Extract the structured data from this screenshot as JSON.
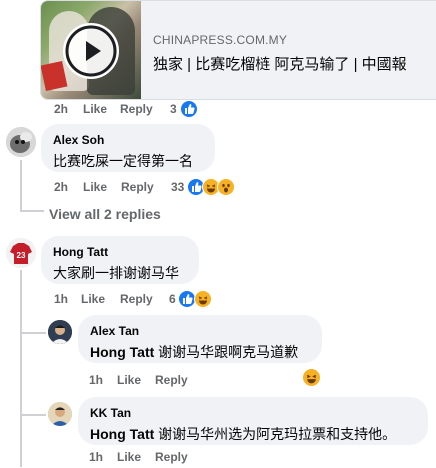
{
  "link_preview": {
    "domain": "CHINAPRESS.COM.MY",
    "title": "独家 | 比赛吃榴梿 阿克马输了 | 中國報",
    "thumbnail_icon": "video-play-icon"
  },
  "top_meta": {
    "time": "2h",
    "like": "Like",
    "reply": "Reply",
    "count": "3"
  },
  "comments": [
    {
      "author": "Alex Soh",
      "text": "比赛吃屎一定得第一名",
      "time": "2h",
      "like": "Like",
      "reply": "Reply",
      "reaction_count": "33"
    },
    {
      "author": "Hong Tatt",
      "text": "大家刷一排谢谢马华",
      "time": "1h",
      "like": "Like",
      "reply": "Reply",
      "reaction_count": "6"
    }
  ],
  "view_replies": "View all 2 replies",
  "replies": [
    {
      "author": "Alex Tan",
      "tag": "Hong Tatt",
      "text": " 谢谢马华跟啊克马道歉",
      "time": "1h",
      "like": "Like",
      "reply": "Reply"
    },
    {
      "author": "KK Tan",
      "tag": "Hong Tatt",
      "text": " 谢谢马华州选为阿克玛拉票和支持他。",
      "time": "1h",
      "like": "Like",
      "reply": "Reply"
    }
  ],
  "colors": {
    "like_blue": "#1877f2",
    "haha_yellow": "#f7b125",
    "meta_gray": "#65676b",
    "bubble": "#f0f2f5"
  },
  "jersey_number": "23"
}
